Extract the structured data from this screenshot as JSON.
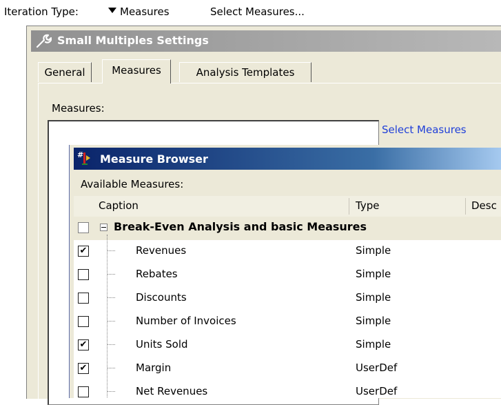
{
  "toolbar": {
    "iteration_label": "Iteration Type:",
    "iteration_value": "Measures",
    "select_measures": "Select Measures..."
  },
  "settings": {
    "title": "Small Multiples Settings",
    "tabs": [
      {
        "label": "General"
      },
      {
        "label": "Measures"
      },
      {
        "label": "Analysis Templates"
      }
    ],
    "active_tab": "Measures",
    "measures_label": "Measures:",
    "select_link": "Select Measures"
  },
  "browser": {
    "title": "Measure Browser",
    "available_label": "Available Measures:",
    "columns": {
      "caption": "Caption",
      "type": "Type",
      "desc": "Desc"
    },
    "group": {
      "label": "Break-Even Analysis and basic Measures",
      "checked": false
    },
    "rows": [
      {
        "caption": "Revenues",
        "type": "Simple",
        "checked": true
      },
      {
        "caption": "Rebates",
        "type": "Simple",
        "checked": false
      },
      {
        "caption": "Discounts",
        "type": "Simple",
        "checked": false
      },
      {
        "caption": "Number of Invoices",
        "type": "Simple",
        "checked": false
      },
      {
        "caption": "Units Sold",
        "type": "Simple",
        "checked": true
      },
      {
        "caption": "Margin",
        "type": "UserDef",
        "checked": true
      },
      {
        "caption": "Net Revenues",
        "type": "UserDef",
        "checked": false
      }
    ]
  },
  "colors": {
    "link": "#1f3fd9",
    "browser_title": "#0a246a",
    "dialog_bg": "#ece9d8"
  }
}
